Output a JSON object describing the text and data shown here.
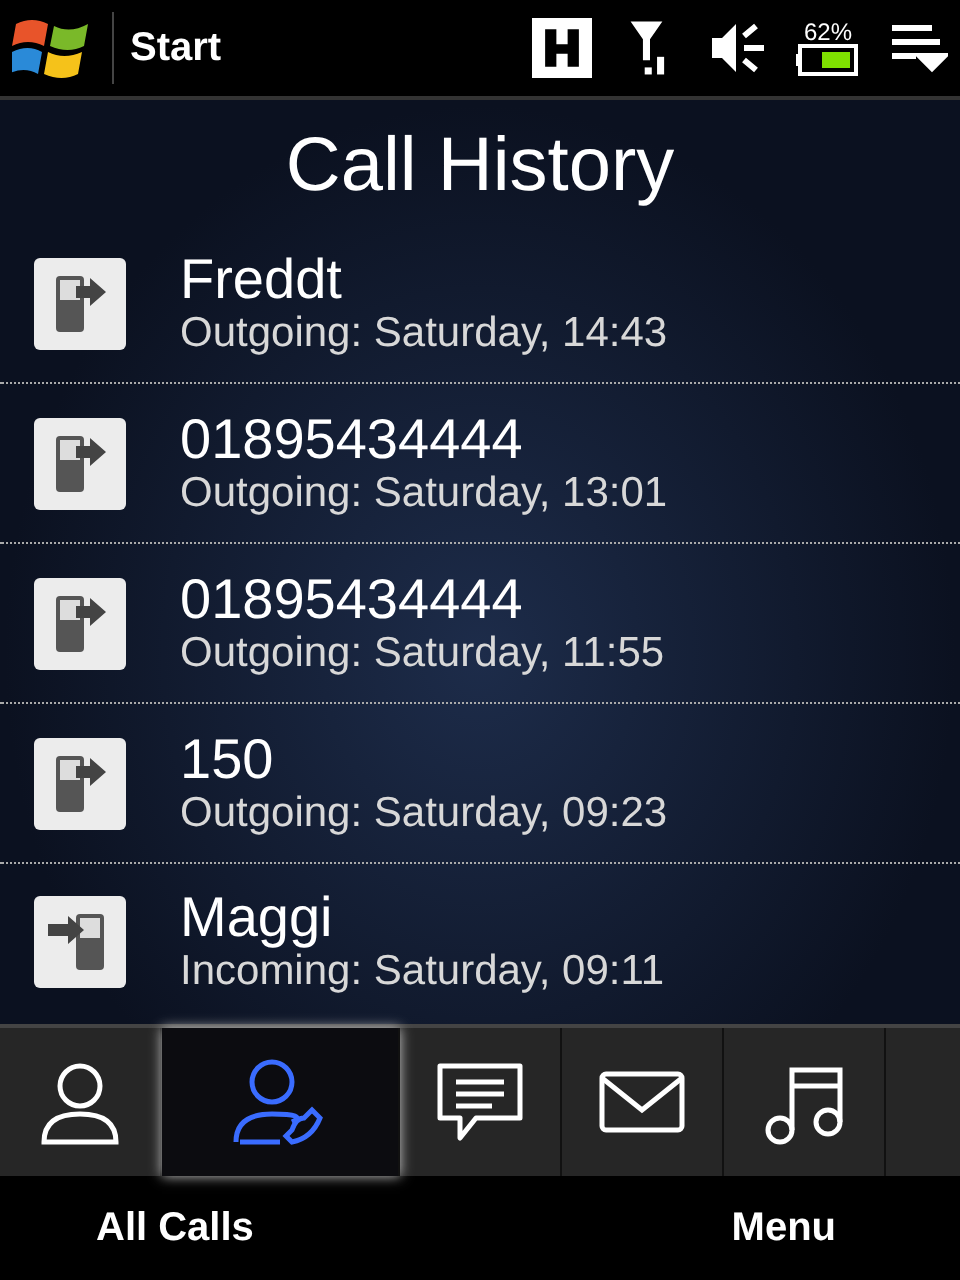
{
  "top_bar": {
    "title": "Start",
    "battery_text": "62%"
  },
  "header": {
    "title": "Call History"
  },
  "calls": [
    {
      "name": "Freddt",
      "detail": "Outgoing: Saturday, 14:43",
      "kind": "outgoing"
    },
    {
      "name": "01895434444",
      "detail": "Outgoing: Saturday, 13:01",
      "kind": "outgoing"
    },
    {
      "name": "01895434444",
      "detail": "Outgoing: Saturday, 11:55",
      "kind": "outgoing"
    },
    {
      "name": "150",
      "detail": "Outgoing: Saturday, 09:23",
      "kind": "outgoing"
    },
    {
      "name": "Maggi",
      "detail": "Incoming: Saturday, 09:11",
      "kind": "incoming"
    }
  ],
  "tabs": [
    {
      "kind": "people",
      "selected": false
    },
    {
      "kind": "calls",
      "selected": true
    },
    {
      "kind": "messages",
      "selected": false
    },
    {
      "kind": "mail",
      "selected": false
    },
    {
      "kind": "music",
      "selected": false
    }
  ],
  "soft_keys": [
    "All Calls",
    "Menu"
  ]
}
